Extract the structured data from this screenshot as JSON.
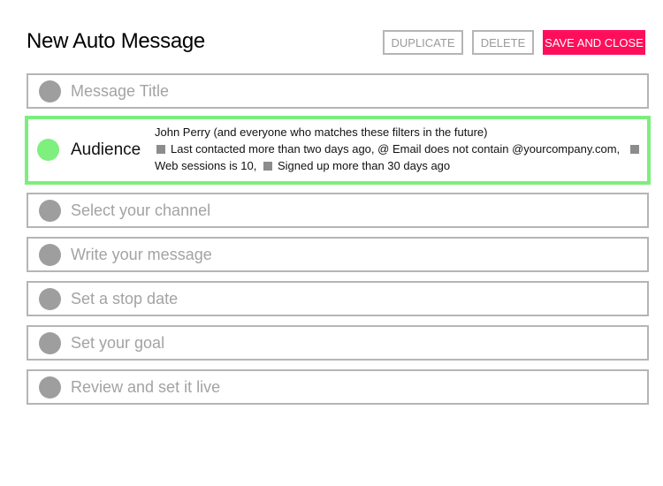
{
  "header": {
    "title": "New Auto Message",
    "duplicate_label": "DUPLICATE",
    "delete_label": "DELETE",
    "save_label": "SAVE AND CLOSE"
  },
  "colors": {
    "accent": "#ff0f5b",
    "active_green": "#7df07d",
    "inactive_gray": "#9e9e9e"
  },
  "steps": [
    {
      "label": "Message Title",
      "state": "inactive"
    },
    {
      "label": "Audience",
      "state": "active"
    },
    {
      "label": "Select your channel",
      "state": "inactive"
    },
    {
      "label": "Write your message",
      "state": "inactive"
    },
    {
      "label": "Set a stop date",
      "state": "inactive"
    },
    {
      "label": "Set your goal",
      "state": "inactive"
    },
    {
      "label": "Review and set it live",
      "state": "inactive"
    }
  ],
  "audience": {
    "summary": "John Perry (and everyone who matches these filters in the future)",
    "filters": [
      "Last contacted more than two days ago, @ Email does not contain @yourcompany.com,",
      "Web sessions is 10,",
      "Signed up more than 30 days ago"
    ]
  }
}
